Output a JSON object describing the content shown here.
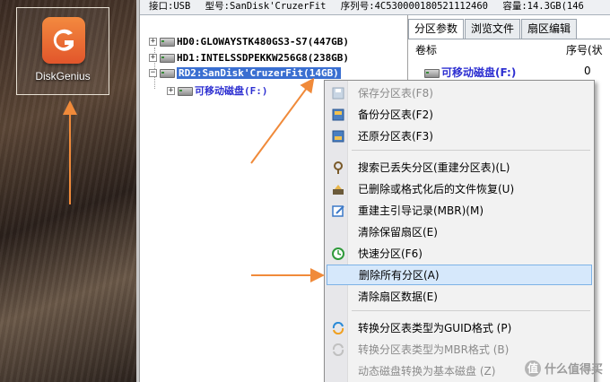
{
  "desktop": {
    "app_name": "DiskGenius",
    "app_logo_letter": "G",
    "logo_color": "#ef6e34"
  },
  "infobar": {
    "interface": "接口:USB",
    "model": "型号:SanDisk'CruzerFit",
    "serial": "序列号:4C530000180521112460",
    "capacity": "容量:14.3GB(146"
  },
  "tree": {
    "disks": [
      {
        "label": "HD0:GLOWAYSTK480GS3-S7(447GB)",
        "expander": "+"
      },
      {
        "label": "HD1:INTELSSDPEKKW256G8(238GB)",
        "expander": "+"
      },
      {
        "label": "RD2:SanDisk'CruzerFit(14GB)",
        "expander": "−",
        "selected": true
      }
    ],
    "partition": {
      "label": "可移动磁盘(F:)",
      "expander": "+"
    }
  },
  "right_panel": {
    "tabs": [
      "分区参数",
      "浏览文件",
      "扇区编辑"
    ],
    "col_volume": "卷标",
    "col_index": "序号(状",
    "volume_name": "可移动磁盘(F:)",
    "volume_index": "0"
  },
  "context_menu": {
    "items": [
      {
        "label": "保存分区表(F8)",
        "icon": "save-icon",
        "disabled": true
      },
      {
        "label": "备份分区表(F2)",
        "icon": "backup-icon"
      },
      {
        "label": "还原分区表(F3)",
        "icon": "restore-icon"
      },
      {
        "label": "搜索已丢失分区(重建分区表)(L)",
        "icon": "search-icon"
      },
      {
        "label": "已删除或格式化后的文件恢复(U)",
        "icon": "recover-icon"
      },
      {
        "label": "重建主引导记录(MBR)(M)",
        "icon": "edit-icon"
      },
      {
        "label": "清除保留扇区(E)",
        "icon": ""
      },
      {
        "label": "快速分区(F6)",
        "icon": "clock-icon"
      },
      {
        "label": "删除所有分区(A)",
        "icon": "",
        "hover": true
      },
      {
        "label": "清除扇区数据(E)",
        "icon": ""
      },
      {
        "label": "转换分区表类型为GUID格式 (P)",
        "icon": "convert-icon"
      },
      {
        "label": "转换分区表类型为MBR格式 (B)",
        "icon": "convert-icon",
        "disabled": true
      },
      {
        "label": "动态磁盘转换为基本磁盘 (Z)",
        "icon": "",
        "disabled": true
      }
    ]
  },
  "watermark": {
    "badge": "值",
    "text": "什么值得买"
  },
  "colors": {
    "arrow": "#f08a3a",
    "selection": "#3a6fd1",
    "menu_hover": "#d6e8fb",
    "partition_text": "#2d2fd1"
  }
}
